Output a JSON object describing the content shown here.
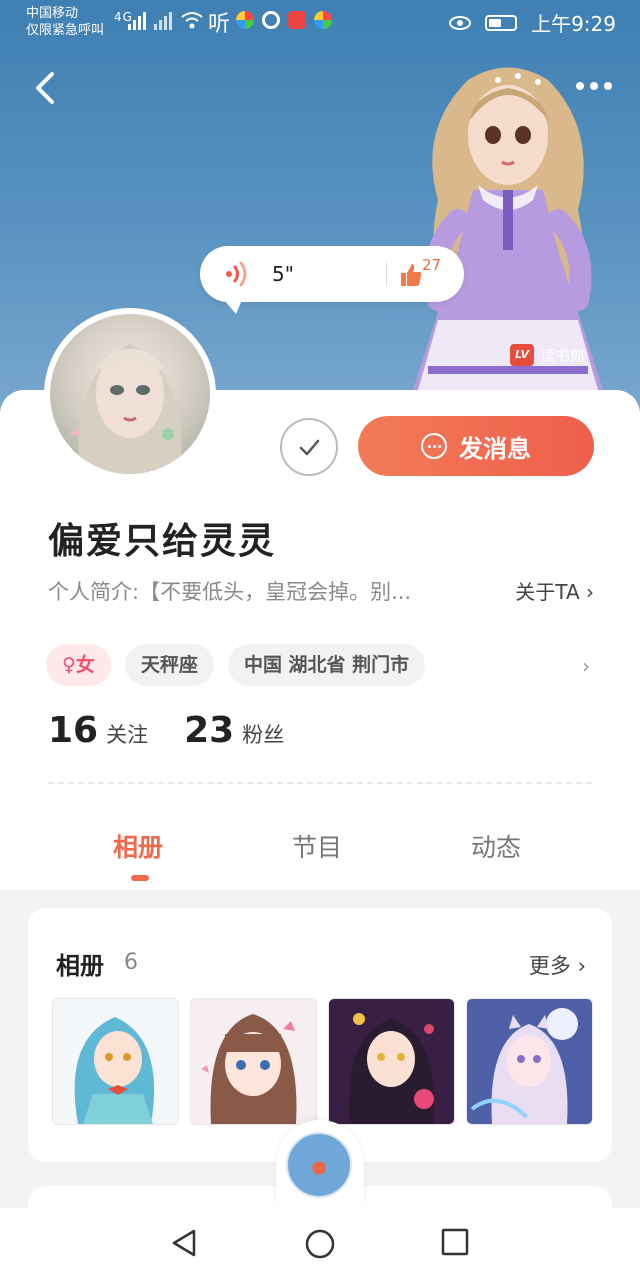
{
  "status_bar": {
    "carrier": "中国移动",
    "emergency": "仅限紧急呼叫",
    "network": "4G",
    "listen_label": "听",
    "time": "上午9:29"
  },
  "header": {
    "back_icon": "chevron-left-icon",
    "more_icon": "more-dots-icon",
    "brand_badge": "LV",
    "brand_name": "读书郎"
  },
  "voice": {
    "duration": "5\"",
    "likes": "27"
  },
  "profile": {
    "username": "偏爱只给灵灵",
    "bio": "个人简介:【不要低头，皇冠会掉。别...",
    "about_link": "关于TA",
    "message_button": "发消息",
    "tags": [
      "♀女",
      "天秤座",
      "中国 湖北省 荆门市"
    ],
    "following_count": "16",
    "following_label": "关注",
    "followers_count": "23",
    "followers_label": "粉丝"
  },
  "tabs": [
    {
      "label": "相册",
      "active": true
    },
    {
      "label": "节目",
      "active": false
    },
    {
      "label": "动态",
      "active": false
    }
  ],
  "album": {
    "title": "相册",
    "count": "6",
    "more": "更多"
  },
  "colors": {
    "accent": "#ef6a4b",
    "hero_blue": "#4a87b9",
    "female": "#ef4f6a"
  }
}
